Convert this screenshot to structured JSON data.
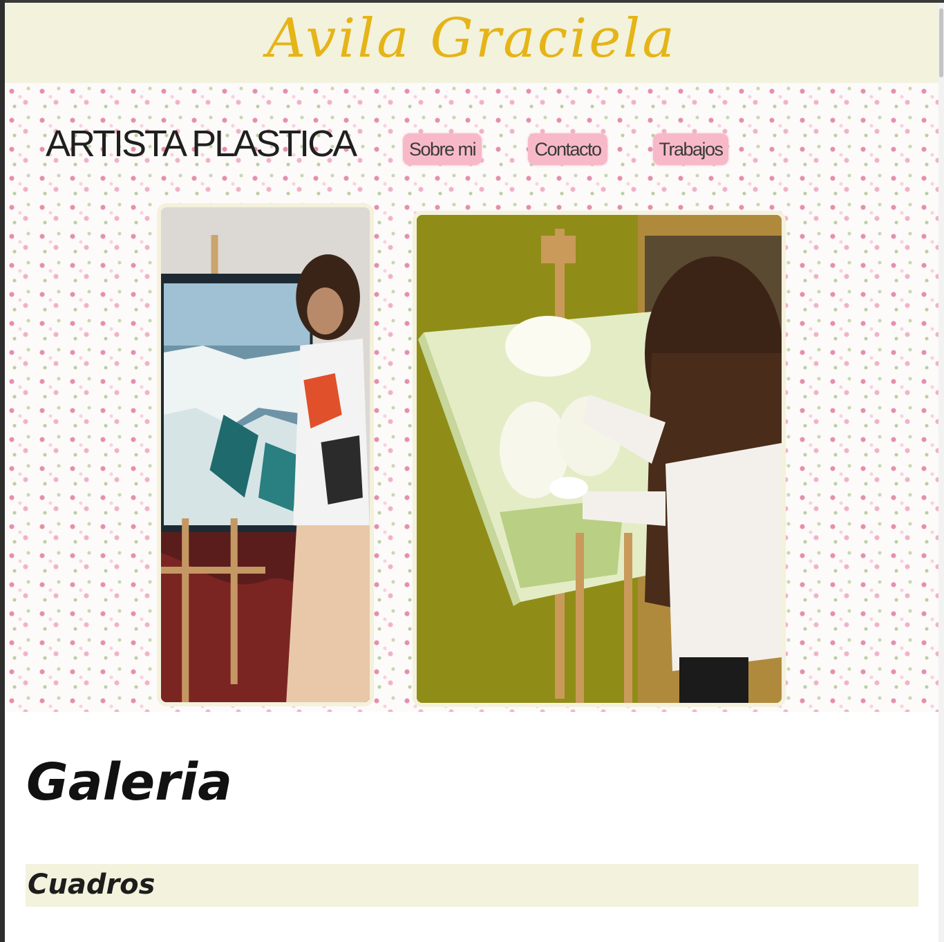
{
  "header": {
    "site_title": "Avila Graciela"
  },
  "hero": {
    "subtitle": "ARTISTA PLASTICA",
    "nav": [
      {
        "label": "Sobre mi"
      },
      {
        "label": "Contacto"
      },
      {
        "label": "Trabajos"
      }
    ]
  },
  "gallery": {
    "title": "Galeria",
    "sections": [
      {
        "title": "Cuadros"
      }
    ]
  },
  "colors": {
    "header_bg": "#f3f2dd",
    "title_gold": "#e5b417",
    "nav_pink": "#f7b9c8"
  }
}
